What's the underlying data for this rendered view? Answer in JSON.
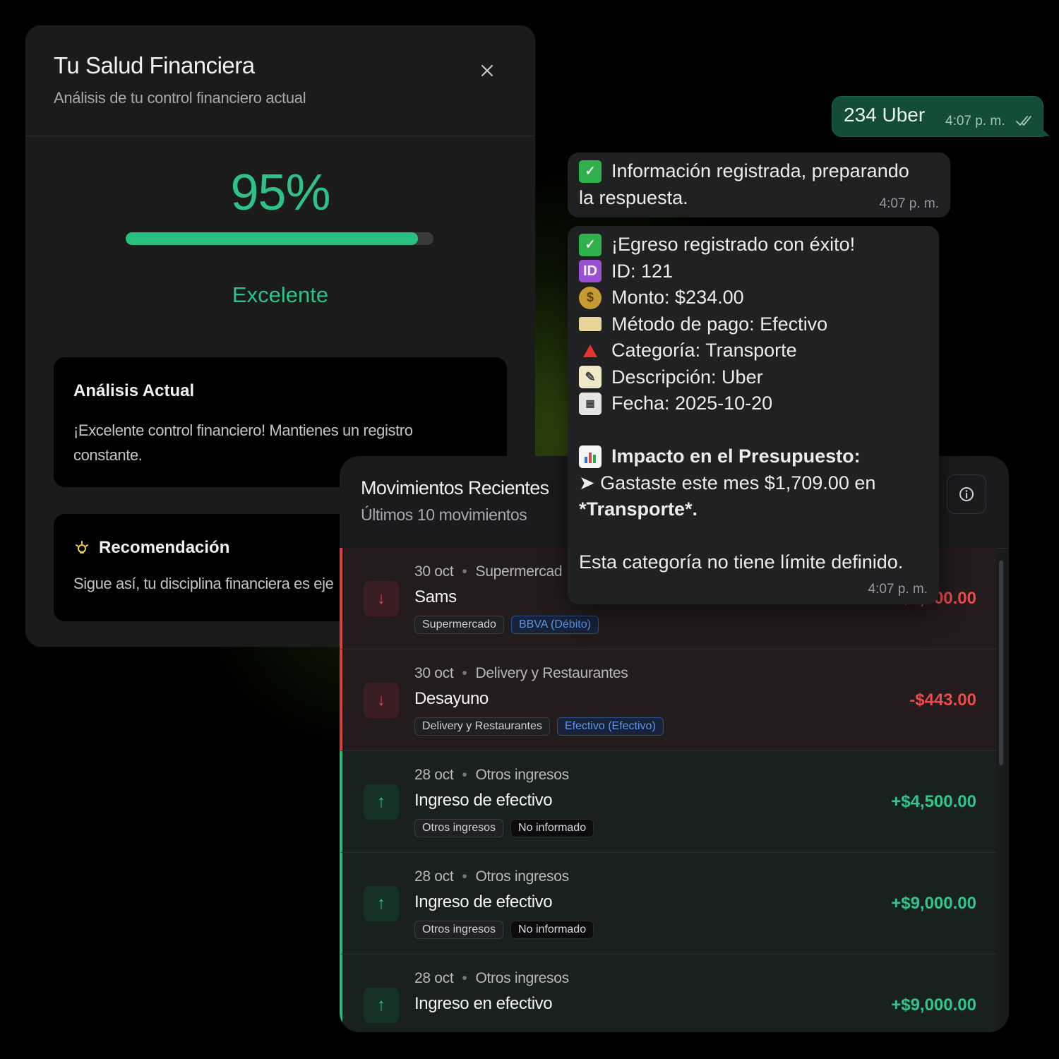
{
  "health": {
    "title": "Tu Salud Financiera",
    "subtitle": "Análisis de tu control financiero actual",
    "score": "95%",
    "progress_fraction": 0.95,
    "rating": "Excelente",
    "analysis_title": "Análisis Actual",
    "analysis_text": "¡Excelente control financiero! Mantienes un registro constante.",
    "recommendation_title": "Recomendación",
    "recommendation_text": "Sigue así, tu disciplina financiera es eje"
  },
  "movements": {
    "title": "Movimientos Recientes",
    "subtitle": "Últimos 10 movimientos",
    "rows": [
      {
        "date": "30 oct",
        "category": "Supermercad",
        "name": "Sams",
        "tag1": "Supermercado",
        "tag2": "BBVA (Débito)",
        "amount": "-$1,500.00",
        "type": "out"
      },
      {
        "date": "30 oct",
        "category": "Delivery y Restaurantes",
        "name": "Desayuno",
        "tag1": "Delivery y Restaurantes",
        "tag2": "Efectivo (Efectivo)",
        "amount": "-$443.00",
        "type": "out"
      },
      {
        "date": "28 oct",
        "category": "Otros ingresos",
        "name": "Ingreso de efectivo",
        "tag1": "Otros ingresos",
        "tag2": "No informado",
        "amount": "+$4,500.00",
        "type": "in"
      },
      {
        "date": "28 oct",
        "category": "Otros ingresos",
        "name": "Ingreso de efectivo",
        "tag1": "Otros ingresos",
        "tag2": "No informado",
        "amount": "+$9,000.00",
        "type": "in"
      },
      {
        "date": "28 oct",
        "category": "Otros ingresos",
        "name": "Ingreso en efectivo",
        "tag1": "",
        "tag2": "",
        "amount": "+$9,000.00",
        "type": "in"
      }
    ]
  },
  "chat": {
    "sent_text": "234 Uber",
    "sent_time": "4:07 p. m.",
    "msg1_line1": "Información registrada, preparando",
    "msg1_line2": "la respuesta.",
    "msg1_time": "4:07 p. m.",
    "msg2": {
      "success": "¡Egreso registrado con éxito!",
      "id": "ID: 121",
      "amount": "Monto: $234.00",
      "method": "Método de pago: Efectivo",
      "category": "Categoría: Transporte",
      "description": "Descripción: Uber",
      "date": "Fecha: 2025-10-20",
      "impact_title": "Impacto en el Presupuesto:",
      "impact_line1": "➤ Gastaste este mes $1,709.00 en",
      "impact_line2": "*Transporte*.",
      "limit_text": "Esta categoría no tiene límite definido.",
      "time": "4:07 p. m."
    }
  },
  "colors": {
    "accent_green": "#2fc288",
    "expense_red": "#ee4a4a",
    "chat_sent": "#144d36"
  }
}
